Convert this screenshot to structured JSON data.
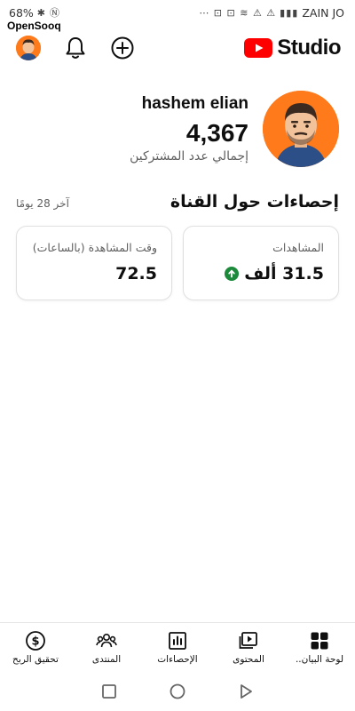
{
  "status_bar": {
    "carrier": "ZAIN JO",
    "battery": "68%",
    "left_icons": "⋯ ⊡ ⊡ ≋ ⚠ ⚠"
  },
  "watermark": "OpenSooq",
  "app": {
    "logo_text": "Studio",
    "brand_color": "#ff0000"
  },
  "channel": {
    "name": "hashem elian",
    "subscriber_count": "4,367",
    "subscriber_label": "إجمالي عدد المشتركين"
  },
  "analytics": {
    "title": "إحصاءات حول القناة",
    "period": "آخر 28 يومًا",
    "views": {
      "label": "المشاهدات",
      "value": "31.5 ألف",
      "trend": "up",
      "trend_color": "#1b8a3a"
    },
    "watch_time": {
      "label": "وقت المشاهدة (بالساعات)",
      "value": "72.5"
    }
  },
  "bottom_nav": {
    "items": [
      {
        "label": "تحقيق الربح",
        "icon": "dollar-circle-icon"
      },
      {
        "label": "المنتدى",
        "icon": "community-icon"
      },
      {
        "label": "الإحصاءات",
        "icon": "analytics-icon"
      },
      {
        "label": "المحتوى",
        "icon": "content-icon"
      },
      {
        "label": "لوحة البيان..",
        "icon": "dashboard-icon"
      }
    ]
  },
  "system_nav": {
    "buttons": [
      "recents-button",
      "home-button",
      "back-button"
    ]
  }
}
